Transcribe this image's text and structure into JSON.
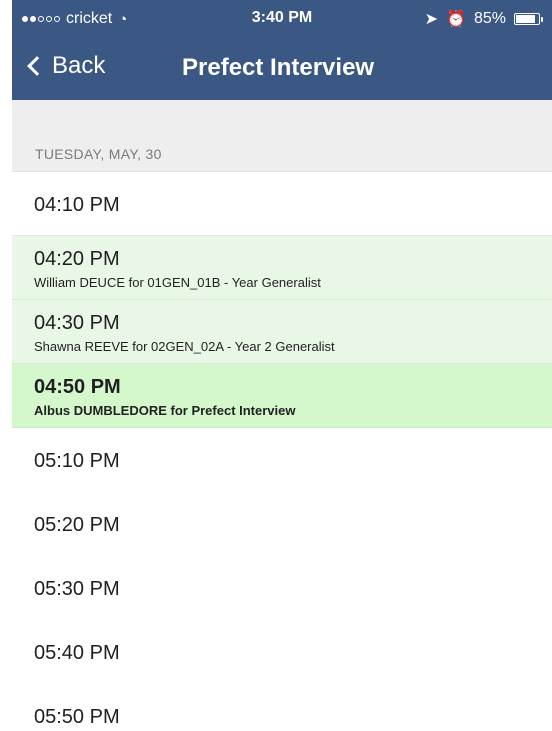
{
  "status_bar": {
    "carrier": "cricket",
    "time": "3:40 PM",
    "battery": "85%",
    "signal_bars": 2,
    "battery_level": 0.85
  },
  "nav": {
    "back_label": "Back",
    "title": "Prefect Interview"
  },
  "section": {
    "date_label": "TUESDAY, MAY, 30"
  },
  "slots": [
    {
      "time": "04:10 PM",
      "booking": ""
    },
    {
      "time": "04:20 PM",
      "booking": "William DEUCE for 01GEN_01B - Year  Generalist"
    },
    {
      "time": "04:30 PM",
      "booking": "Shawna REEVE for 02GEN_02A - Year 2 Generalist"
    },
    {
      "time": "04:50 PM",
      "booking": "Albus DUMBLEDORE for Prefect Interview"
    },
    {
      "time": "05:10 PM",
      "booking": ""
    },
    {
      "time": "05:20 PM",
      "booking": ""
    },
    {
      "time": "05:30 PM",
      "booking": ""
    },
    {
      "time": "05:40 PM",
      "booking": ""
    },
    {
      "time": "05:50 PM",
      "booking": ""
    }
  ],
  "colors": {
    "nav_bar": "#3b5784",
    "booked_row": "#e9f8e6",
    "my_booking_row": "#d4f7cc",
    "section_background": "#eeeeee"
  }
}
